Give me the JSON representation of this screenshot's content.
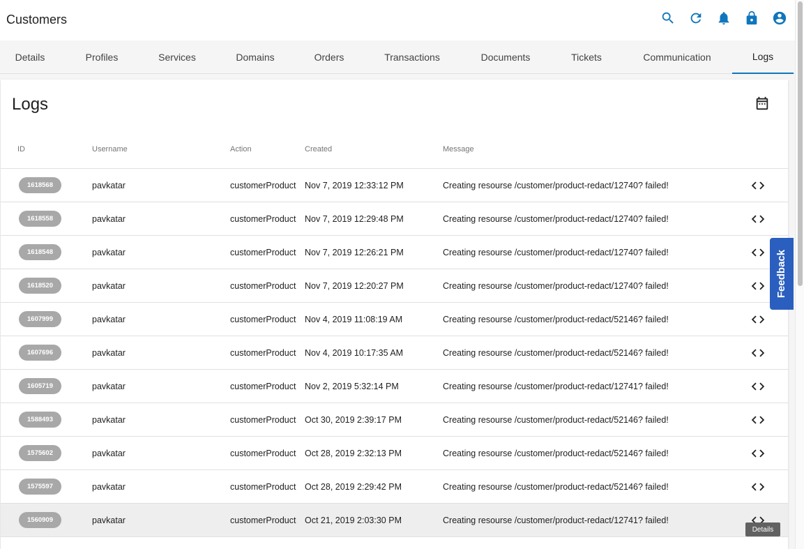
{
  "app": {
    "title": "Customers"
  },
  "toolbar": {
    "icons": [
      "search-icon",
      "refresh-icon",
      "bell-icon",
      "lock-icon",
      "account-circle-icon"
    ]
  },
  "tabs": [
    {
      "label": "Details"
    },
    {
      "label": "Profiles"
    },
    {
      "label": "Services"
    },
    {
      "label": "Domains"
    },
    {
      "label": "Orders"
    },
    {
      "label": "Transactions"
    },
    {
      "label": "Documents"
    },
    {
      "label": "Tickets"
    },
    {
      "label": "Communication"
    },
    {
      "label": "Logs",
      "active": true
    }
  ],
  "logs": {
    "title": "Logs",
    "columns": {
      "id": "ID",
      "username": "Username",
      "action": "Action",
      "created": "Created",
      "message": "Message"
    },
    "rows": [
      {
        "id": "1618568",
        "username": "pavkatar",
        "action": "customerProduct",
        "created": "Nov 7, 2019 12:33:12 PM",
        "message": "Creating resourse /customer/product-redact/12740? failed!"
      },
      {
        "id": "1618558",
        "username": "pavkatar",
        "action": "customerProduct",
        "created": "Nov 7, 2019 12:29:48 PM",
        "message": "Creating resourse /customer/product-redact/12740? failed!"
      },
      {
        "id": "1618548",
        "username": "pavkatar",
        "action": "customerProduct",
        "created": "Nov 7, 2019 12:26:21 PM",
        "message": "Creating resourse /customer/product-redact/12740? failed!"
      },
      {
        "id": "1618520",
        "username": "pavkatar",
        "action": "customerProduct",
        "created": "Nov 7, 2019 12:20:27 PM",
        "message": "Creating resourse /customer/product-redact/12740? failed!"
      },
      {
        "id": "1607999",
        "username": "pavkatar",
        "action": "customerProduct",
        "created": "Nov 4, 2019 11:08:19 AM",
        "message": "Creating resourse /customer/product-redact/52146? failed!"
      },
      {
        "id": "1607696",
        "username": "pavkatar",
        "action": "customerProduct",
        "created": "Nov 4, 2019 10:17:35 AM",
        "message": "Creating resourse /customer/product-redact/52146? failed!"
      },
      {
        "id": "1605719",
        "username": "pavkatar",
        "action": "customerProduct",
        "created": "Nov 2, 2019 5:32:14 PM",
        "message": "Creating resourse /customer/product-redact/12741? failed!"
      },
      {
        "id": "1588493",
        "username": "pavkatar",
        "action": "customerProduct",
        "created": "Oct 30, 2019 2:39:17 PM",
        "message": "Creating resourse /customer/product-redact/52146? failed!"
      },
      {
        "id": "1575602",
        "username": "pavkatar",
        "action": "customerProduct",
        "created": "Oct 28, 2019 2:32:13 PM",
        "message": "Creating resourse /customer/product-redact/52146? failed!"
      },
      {
        "id": "1575597",
        "username": "pavkatar",
        "action": "customerProduct",
        "created": "Oct 28, 2019 2:29:42 PM",
        "message": "Creating resourse /customer/product-redact/52146? failed!"
      },
      {
        "id": "1560909",
        "username": "pavkatar",
        "action": "customerProduct",
        "created": "Oct 21, 2019 2:03:30 PM",
        "message": "Creating resourse /customer/product-redact/12741? failed!",
        "hovered": true
      }
    ]
  },
  "tooltip": {
    "text": "Details"
  },
  "feedback": {
    "label": "Feedback",
    "color": "#2b5fbf"
  },
  "colors": {
    "accent": "#0f76bd",
    "chip": "#a8a8a8"
  }
}
